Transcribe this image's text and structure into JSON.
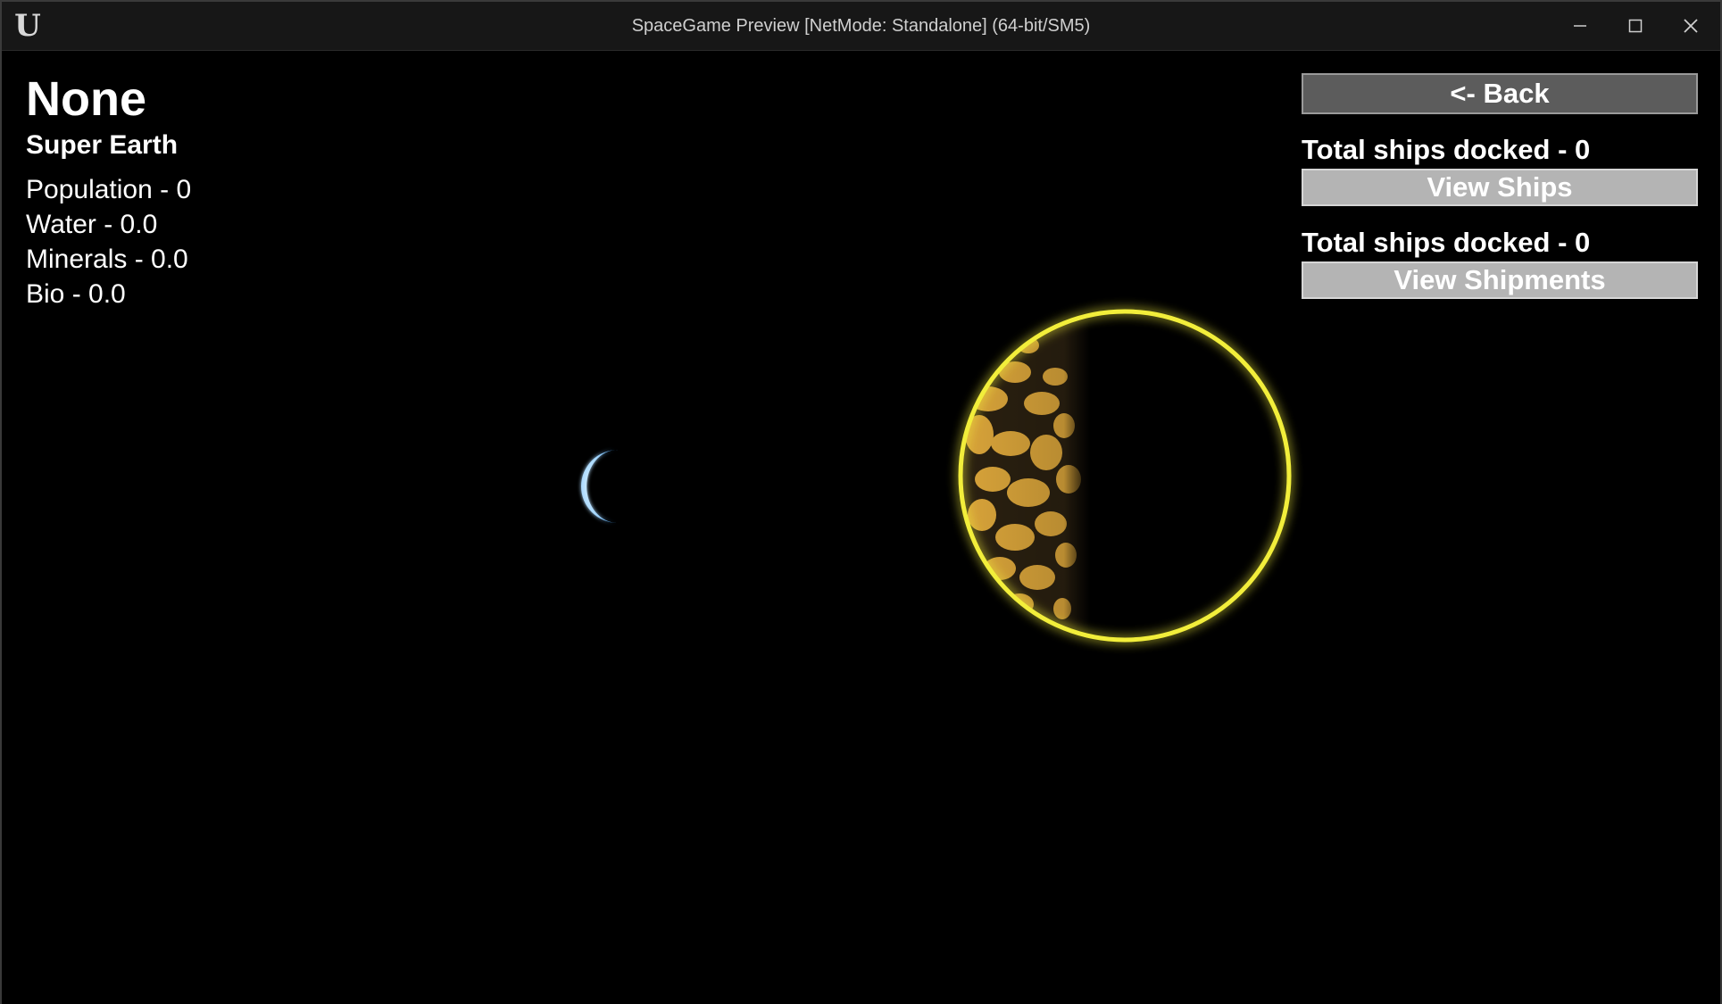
{
  "window": {
    "title": "SpaceGame Preview [NetMode: Standalone]  (64-bit/SM5)",
    "logo_text": "U",
    "controls": [
      "minimize-icon",
      "maximize-icon",
      "close-icon"
    ]
  },
  "planet": {
    "name": "None",
    "type": "Super Earth",
    "stats": {
      "population": "Population - 0",
      "water": "Water - 0.0",
      "minerals": "Minerals - 0.0",
      "bio": "Bio - 0.0"
    }
  },
  "side_panel": {
    "back_label": "<- Back",
    "ships_docked_label": "Total ships docked - 0",
    "view_ships_label": "View Ships",
    "shipments_docked_label": "Total ships docked - 0",
    "view_shipments_label": "View Shipments"
  },
  "colors": {
    "background": "#000000",
    "selection_ring": "#f2ee3a",
    "planet_surface": "#d9a43a",
    "moon": "#9fd4ff",
    "button_primary": "#5c5c5c",
    "button_secondary": "#b4b4b4"
  }
}
